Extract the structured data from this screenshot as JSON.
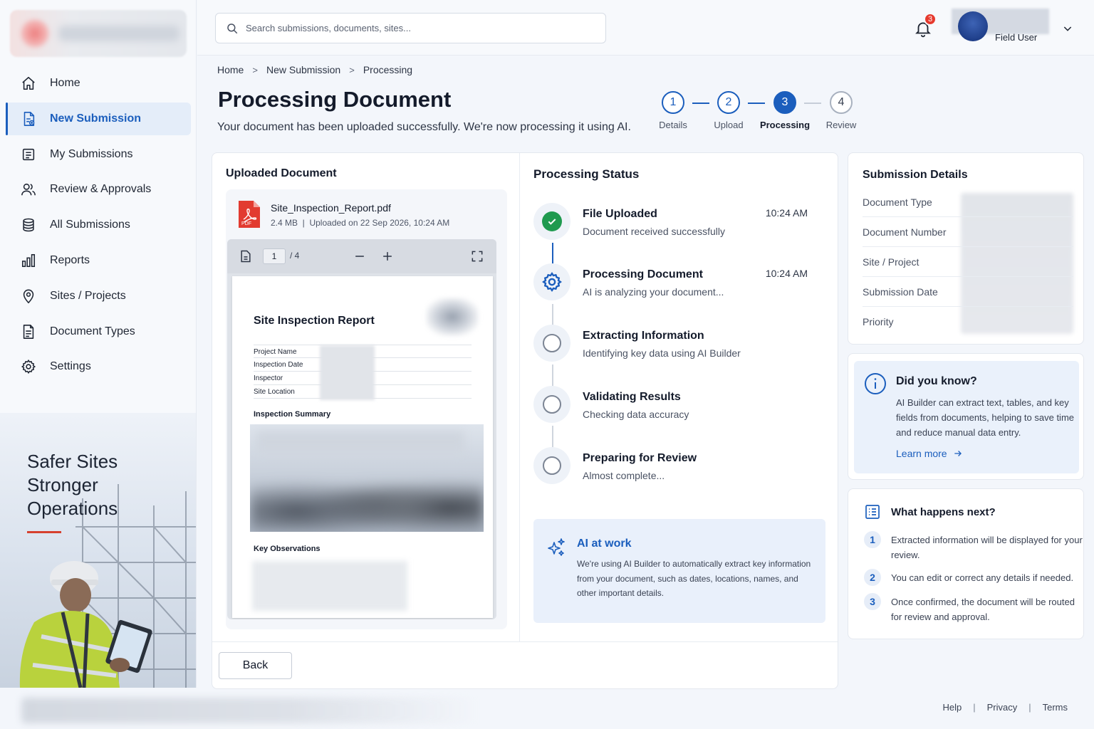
{
  "search": {
    "placeholder": "Search submissions, documents, sites..."
  },
  "topbar": {
    "notification_count": "3",
    "user_label": "Field User"
  },
  "sidebar": {
    "items": [
      {
        "label": "Home",
        "icon": "home-icon"
      },
      {
        "label": "New Submission",
        "icon": "document-add-icon"
      },
      {
        "label": "My Submissions",
        "icon": "list-icon"
      },
      {
        "label": "Review & Approvals",
        "icon": "users-icon"
      },
      {
        "label": "All Submissions",
        "icon": "database-icon"
      },
      {
        "label": "Reports",
        "icon": "bar-chart-icon"
      },
      {
        "label": "Sites / Projects",
        "icon": "location-pin-icon"
      },
      {
        "label": "Document Types",
        "icon": "file-text-icon"
      },
      {
        "label": "Settings",
        "icon": "gear-icon"
      }
    ],
    "promo": {
      "line1": "Safer Sites",
      "line2": "Stronger",
      "line3": "Operations"
    }
  },
  "breadcrumb": [
    "Home",
    "New Submission",
    "Processing"
  ],
  "page": {
    "title": "Processing Document",
    "subtitle": "Your document has been uploaded successfully. We're now processing it using AI."
  },
  "stepper": [
    {
      "num": "1",
      "label": "Details",
      "state": "complete"
    },
    {
      "num": "2",
      "label": "Upload",
      "state": "complete"
    },
    {
      "num": "3",
      "label": "Processing",
      "state": "current"
    },
    {
      "num": "4",
      "label": "Review",
      "state": "pending"
    }
  ],
  "uploaded": {
    "section_title": "Uploaded Document",
    "file_name": "Site_Inspection_Report.pdf",
    "file_meta": "2.4 MB  |  Uploaded on 22 Sep 2026, 10:24 AM",
    "viewer": {
      "page": "1",
      "total": "/ 4"
    },
    "doc": {
      "title": "Site Inspection Report",
      "fields": [
        "Project Name",
        "Inspection Date",
        "Inspector",
        "Site Location"
      ],
      "summary_heading": "Inspection Summary",
      "observations_heading": "Key Observations"
    }
  },
  "processing": {
    "section_title": "Processing Status",
    "steps": [
      {
        "title": "File Uploaded",
        "sub": "Document received successfully",
        "time": "10:24 AM",
        "state": "done"
      },
      {
        "title": "Processing Document",
        "sub": "AI is analyzing your document...",
        "time": "10:24 AM",
        "state": "active"
      },
      {
        "title": "Extracting Information",
        "sub": "Identifying key data using AI Builder",
        "time": "",
        "state": "pending"
      },
      {
        "title": "Validating Results",
        "sub": "Checking data accuracy",
        "time": "",
        "state": "pending"
      },
      {
        "title": "Preparing for Review",
        "sub": "Almost complete...",
        "time": "",
        "state": "pending"
      }
    ],
    "ai_box": {
      "title": "AI at work",
      "text": "We're using AI Builder to automatically extract key information from your document, such as dates, locations, names, and other important details."
    }
  },
  "actions": {
    "back": "Back"
  },
  "details": {
    "title": "Submission Details",
    "rows": [
      "Document Type",
      "Document Number",
      "Site / Project",
      "Submission Date",
      "Priority"
    ]
  },
  "did_you_know": {
    "title": "Did you know?",
    "text": "AI Builder can extract text, tables, and key fields from documents, helping to save time and reduce manual data entry.",
    "link": "Learn more"
  },
  "next": {
    "title": "What happens next?",
    "items": [
      {
        "num": "1",
        "text": "Extracted information will be displayed for your review."
      },
      {
        "num": "2",
        "text": "You can edit or correct any details if needed."
      },
      {
        "num": "3",
        "text": "Once confirmed, the document will be routed for review and approval."
      }
    ]
  },
  "footer": {
    "links": [
      "Help",
      "Privacy",
      "Terms"
    ]
  },
  "colors": {
    "accent": "#1b5ebd",
    "success": "#1f9a4f",
    "badge": "#e63a2e",
    "promo_bar": "#d6402f"
  }
}
